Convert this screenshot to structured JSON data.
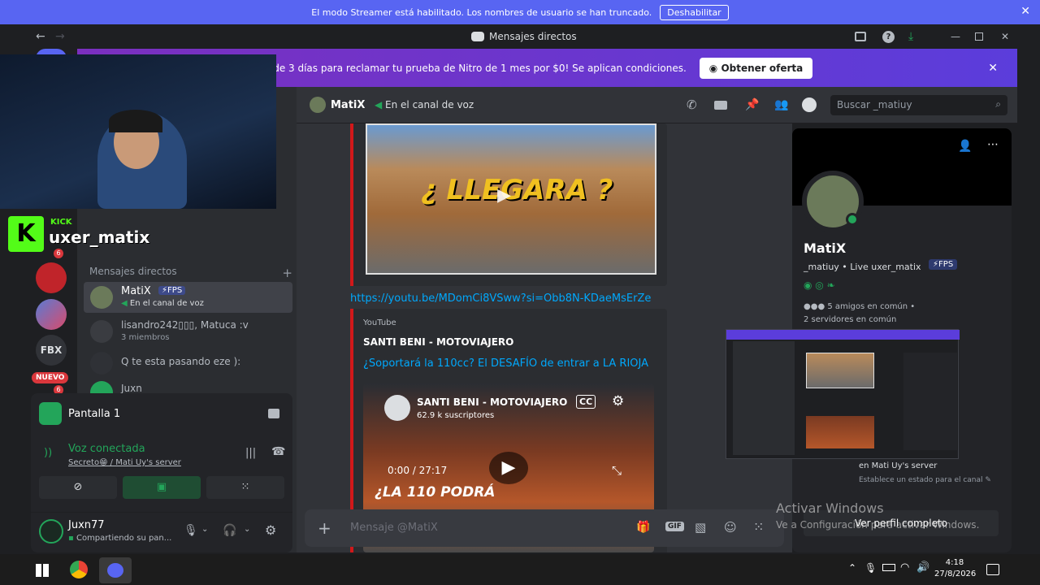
{
  "streamer": {
    "message": "El modo Streamer está habilitado. Los nombres de usuario se han truncado.",
    "disable_label": "Deshabilitar"
  },
  "titlebar": {
    "title": "Mensajes directos"
  },
  "nitro": {
    "message": "¡Solo dispones de 3 días para reclamar tu prueba de Nitro de 1 mes por $0! Se aplican condiciones.",
    "offer_label": "Obtener oferta"
  },
  "overlay": {
    "kick_label": "KICK",
    "username": "uxer_matix"
  },
  "guilds": [
    {
      "label": "FBX"
    },
    {
      "label": "NUEVO"
    }
  ],
  "guild_badges": [
    "6",
    "6"
  ],
  "dm": {
    "header": "Mensajes directos",
    "items": [
      {
        "name": "MatiX",
        "badge": "FPS",
        "sub": "En el canal de voz"
      },
      {
        "name": "lisandro242▯▯▯, Matuca :v",
        "sub": "3 miembros"
      },
      {
        "name": "Q te esta pasando eze ):",
        "sub": ""
      },
      {
        "name": "Juxn",
        "sub": ""
      }
    ]
  },
  "voice": {
    "screen_label": "Pantalla 1",
    "status": "Voz conectada",
    "channel": "Secreto😁 / Mati Uy's server",
    "user": "Juxn77",
    "user_status": "Compartiendo su pan..."
  },
  "topbar": {
    "name": "MatiX",
    "voice_label": "En el canal de voz",
    "search_placeholder": "Buscar _matiuy"
  },
  "chat": {
    "thumb1_title": "¿ LLEGARA ?",
    "link": "https://youtu.be/MDomCi8VSww?si=Obb8N-KDaeMsErZe",
    "embed_provider": "YouTube",
    "embed_author": "SANTI BENI - MOTOVIAJERO",
    "embed_title": "¿Soportará la 110cc? El DESAFÍO de entrar a LA RIOJA",
    "video_channel": "SANTI BENI - MOTOVIAJERO",
    "video_subs": "62.9 k suscriptores",
    "video_time": "0:00 / 27:17",
    "video_caption": "¿LA 110 PODRÁ",
    "cc_label": "CC",
    "input_placeholder": "Mensaje @MatiX",
    "gif_label": "GIF"
  },
  "profile": {
    "name": "MatiX",
    "username": "_matiuy",
    "live": "Live uxer_matix",
    "badge": "FPS",
    "mutual_friends": "5 amigos en común",
    "mutual_servers": "2 servidores en común",
    "activity_server": "en Mati Uy's server",
    "activity_status": "Establece un estado para el canal",
    "full_profile": "Ver perfil completo"
  },
  "windows": {
    "activate_title": "Activar Windows",
    "activate_sub": "Ve a Configuración para activar Windows."
  },
  "taskbar": {
    "time": "4:18",
    "date": "27/8/2026"
  },
  "colors": {
    "blurple": "#5865f2",
    "green": "#23a55a",
    "bg": "#313338"
  }
}
